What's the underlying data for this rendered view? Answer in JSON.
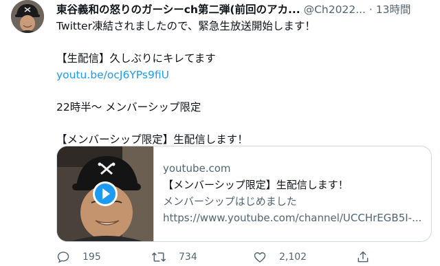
{
  "tweet": {
    "display_name": "東谷義和の怒りのガーシーch第二弾(前回のアカ...",
    "handle": "@Ch2022...",
    "separator": "·",
    "time": "13時間",
    "lines": [
      "Twitter凍結されましたので、緊急生放送開始します！",
      "【生配信】久しぶりにキレてます",
      "22時半〜 メンバーシップ限定",
      "【メンバーシップ限定】生配信します！"
    ],
    "link": "youtu.be/ocJ6YPs9fiU"
  },
  "card": {
    "domain": "youtube.com",
    "title": "【メンバーシップ限定】生配信します！",
    "description": "メンバーシップはじめました",
    "url": "https://www.youtube.com/channel/UCCHrEGB5I-..."
  },
  "actions": {
    "reply_count": "195",
    "retweet_count": "734",
    "like_count": "2,102"
  },
  "colors": {
    "link": "#1d9bf0",
    "play_button": "#1d9bf0",
    "muted": "#536471"
  }
}
